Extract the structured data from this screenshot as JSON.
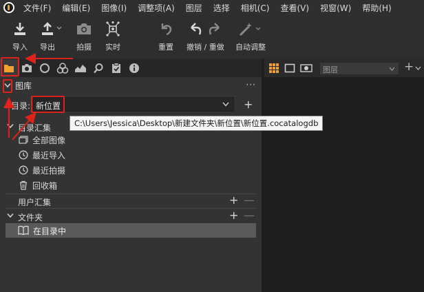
{
  "menu": {
    "items": [
      "文件(F)",
      "编辑(E)",
      "图像(I)",
      "调整项(A)",
      "图层",
      "选择",
      "相机(C)",
      "查看(V)",
      "视窗(W)",
      "帮助(H)"
    ]
  },
  "toolbar": {
    "import_label": "导入",
    "export_label": "导出",
    "capture_label": "拍摄",
    "live_label": "实时",
    "reset_label": "重置",
    "undo_redo_label": "撤销 / 重做",
    "auto_adjust_label": "自动调整"
  },
  "library": {
    "title": "图库",
    "more": "···",
    "catalog_label": "目录:",
    "catalog_value": "新位置",
    "catalog_add": "+",
    "tooltip": "C:\\Users\\Jessica\\Desktop\\新建文件夹\\新位置\\新位置.cocatalogdb",
    "catalog_collections": {
      "title": "目录汇集",
      "items": [
        "全部图像",
        "最近导入",
        "最近拍摄",
        "回收箱"
      ]
    },
    "user_collections": {
      "title": "用户汇集",
      "plus": "+",
      "minus": "—"
    },
    "folders": {
      "title": "文件夹",
      "plus": "+",
      "minus": "—",
      "selected_item": "在目录中"
    }
  },
  "right_panel": {
    "layers_placeholder": "图层",
    "add": "+"
  },
  "colors": {
    "accent_orange": "#f0a030",
    "annotation_red": "#e0221c"
  }
}
